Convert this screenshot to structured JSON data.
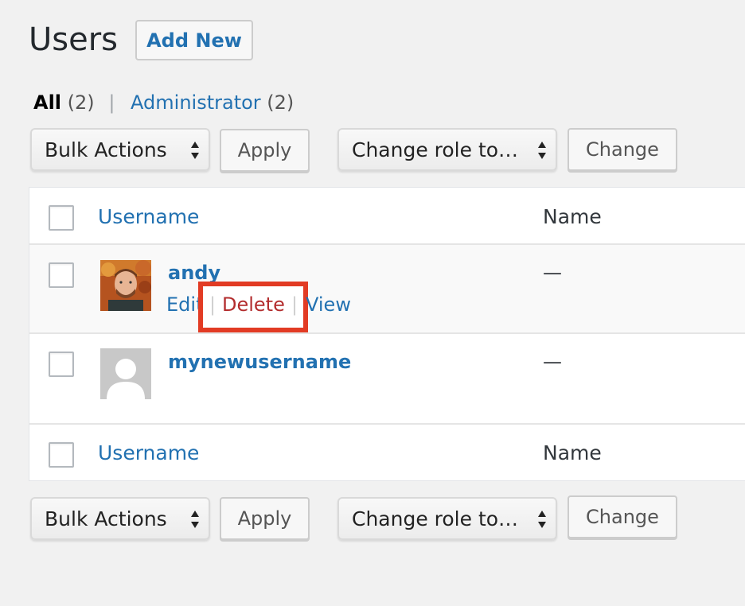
{
  "page": {
    "title": "Users",
    "add_new_label": "Add New"
  },
  "filters": {
    "all_label": "All",
    "all_count": "(2)",
    "separator": "|",
    "administrator_label": "Administrator",
    "administrator_count": "(2)"
  },
  "top_toolbar": {
    "bulk_actions": "Bulk Actions",
    "apply_label": "Apply",
    "change_role": "Change role to…",
    "change_label": "Change"
  },
  "bottom_toolbar": {
    "bulk_actions": "Bulk Actions",
    "apply_label": "Apply",
    "change_role": "Change role to…",
    "change_label": "Change"
  },
  "table": {
    "columns": [
      "Username",
      "Name"
    ],
    "rows": [
      {
        "username": "andy",
        "name": "—",
        "avatar": "photo-avatar",
        "actions": {
          "edit": "Edit",
          "delete": "Delete",
          "view": "View",
          "separator": "|"
        }
      },
      {
        "username": "mynewusername",
        "name": "—",
        "avatar": "default-avatar"
      }
    ]
  },
  "colors": {
    "link": "#2271b1",
    "delete": "#b32d2e",
    "highlight": "#e23b24",
    "background": "#f1f1f1"
  }
}
